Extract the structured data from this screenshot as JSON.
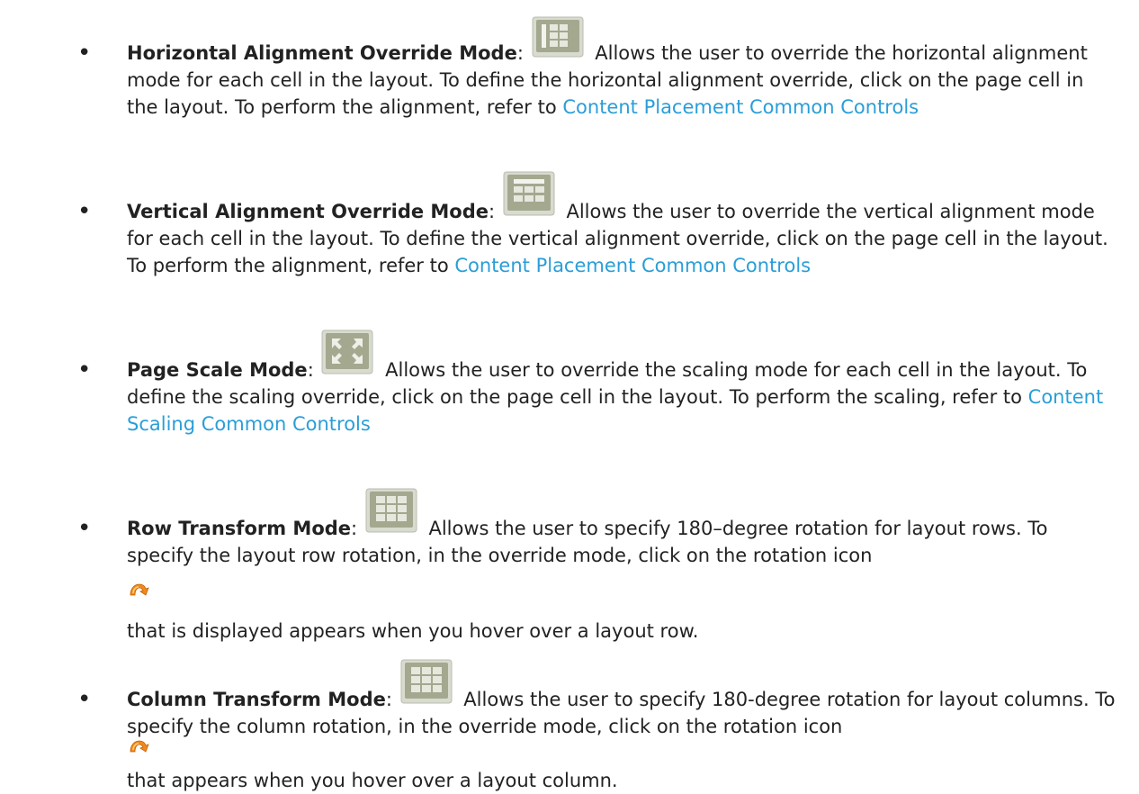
{
  "items": [
    {
      "term": "Horizontal Alignment Override Mode",
      "icon": "horizontal-alignment-grid-icon",
      "desc": "Allows the user to override the horizontal alignment mode for each cell in the layout. To define the horizontal alignment override, click on the page cell in the layout. To perform the alignment, refer to ",
      "link": "Content Placement Common Controls"
    },
    {
      "term": "Vertical Alignment Override Mode",
      "icon": "vertical-alignment-grid-icon",
      "desc": "Allows the user to override the vertical alignment mode for each cell in the layout. To define the vertical alignment override, click on the page cell in the layout. To perform the alignment, refer to ",
      "link": "Content Placement Common Controls"
    },
    {
      "term": "Page Scale Mode",
      "icon": "page-scale-arrows-icon",
      "desc": "Allows the user to override the scaling mode for each cell in the layout. To define the scaling override, click on the page cell in the layout. To perform the scaling, refer to ",
      "link": "Content Scaling Common Controls"
    },
    {
      "term": "Row Transform Mode",
      "icon": "row-transform-grid-icon",
      "desc": "Allows the user to specify 180–degree rotation for layout rows. To specify the layout row rotation, in the override mode, click on the rotation icon",
      "after": "that is displayed appears when you hover over a layout row."
    },
    {
      "term": "Column Transform Mode",
      "icon": "column-transform-grid-icon",
      "desc": "Allows the user to specify 180-degree rotation for layout columns. To specify the column rotation, in the override mode, click on the rotation icon",
      "after": "that appears when you hover over a layout column."
    }
  ],
  "colon": ":",
  "bullet_char": "•"
}
